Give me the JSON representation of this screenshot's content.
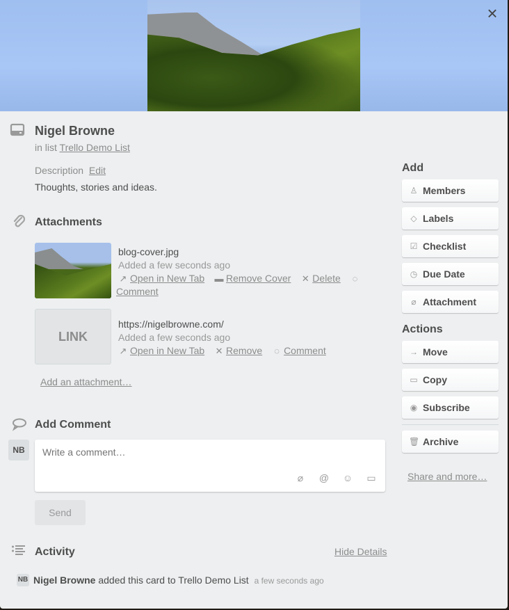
{
  "card": {
    "title": "Nigel Browne",
    "in_list_prefix": "in list",
    "list_name": "Trello Demo List",
    "description_label": "Description",
    "description_edit": "Edit",
    "description_text": "Thoughts, stories and ideas.",
    "close_icon": "×"
  },
  "attachments": {
    "title": "Attachments",
    "items": [
      {
        "name": "blog-cover.jpg",
        "time": "Added a few seconds ago",
        "actions": {
          "open": "Open in New Tab",
          "remove_cover": "Remove Cover",
          "delete": "Delete",
          "comment": "Comment"
        }
      },
      {
        "thumb_label": "LINK",
        "name": "https://nigelbrowne.com/",
        "time": "Added a few seconds ago",
        "actions": {
          "open": "Open in New Tab",
          "remove": "Remove",
          "comment": "Comment"
        }
      }
    ],
    "add_link": "Add an attachment…"
  },
  "comment": {
    "title": "Add Comment",
    "avatar_initials": "NB",
    "placeholder": "Write a comment…",
    "send_label": "Send"
  },
  "activity": {
    "title": "Activity",
    "hide_details": "Hide Details",
    "entries": [
      {
        "avatar_initials": "NB",
        "user": "Nigel Browne",
        "action": "added this card to Trello Demo List",
        "time": "a few seconds ago"
      }
    ]
  },
  "sidebar": {
    "add_heading": "Add",
    "add_buttons": [
      {
        "label": "Members",
        "icon": "person-icon"
      },
      {
        "label": "Labels",
        "icon": "tag-icon"
      },
      {
        "label": "Checklist",
        "icon": "checkbox-icon"
      },
      {
        "label": "Due Date",
        "icon": "clock-icon"
      },
      {
        "label": "Attachment",
        "icon": "paperclip-icon"
      }
    ],
    "actions_heading": "Actions",
    "action_buttons": [
      {
        "label": "Move",
        "icon": "arrow-right-icon"
      },
      {
        "label": "Copy",
        "icon": "card-icon"
      },
      {
        "label": "Subscribe",
        "icon": "eye-icon"
      },
      {
        "label": "Archive",
        "icon": "archive-icon"
      }
    ],
    "share_more": "Share and more…"
  }
}
